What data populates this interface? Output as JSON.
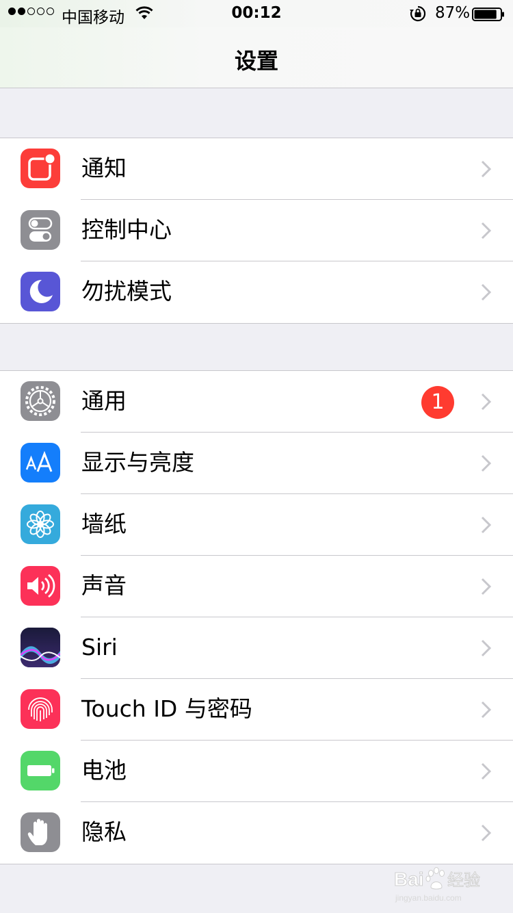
{
  "status_bar": {
    "carrier": "中国移动",
    "time": "00:12",
    "battery_percent": "87%",
    "signal_bars_filled": 2,
    "signal_bars_total": 5,
    "battery_level": 0.87
  },
  "nav": {
    "title": "设置"
  },
  "group1": {
    "items": [
      {
        "label": "通知",
        "icon": "notifications-icon",
        "color": "#fc3d39"
      },
      {
        "label": "控制中心",
        "icon": "control-center-icon",
        "color": "#8e8e93"
      },
      {
        "label": "勿扰模式",
        "icon": "do-not-disturb-moon-icon",
        "color": "#5856d6"
      }
    ]
  },
  "group2": {
    "items": [
      {
        "label": "通用",
        "icon": "gear-icon",
        "color": "#8e8e93",
        "badge": "1"
      },
      {
        "label": "显示与亮度",
        "icon": "display-brightness-aa-icon",
        "color": "#147efb"
      },
      {
        "label": "墙纸",
        "icon": "wallpaper-flower-icon",
        "color": "#35aadc"
      },
      {
        "label": "声音",
        "icon": "speaker-sound-icon",
        "color": "#fc3158"
      },
      {
        "label": "Siri",
        "icon": "siri-icon",
        "color": "#1f1f4f"
      },
      {
        "label": "Touch ID 与密码",
        "icon": "fingerprint-icon",
        "color": "#fc3158"
      },
      {
        "label": "电池",
        "icon": "battery-icon",
        "color": "#53d769"
      },
      {
        "label": "隐私",
        "icon": "privacy-hand-icon",
        "color": "#8e8e93"
      }
    ]
  },
  "watermark": {
    "text": "Baidu经验",
    "subtext": "jingyan.baidu.com"
  }
}
